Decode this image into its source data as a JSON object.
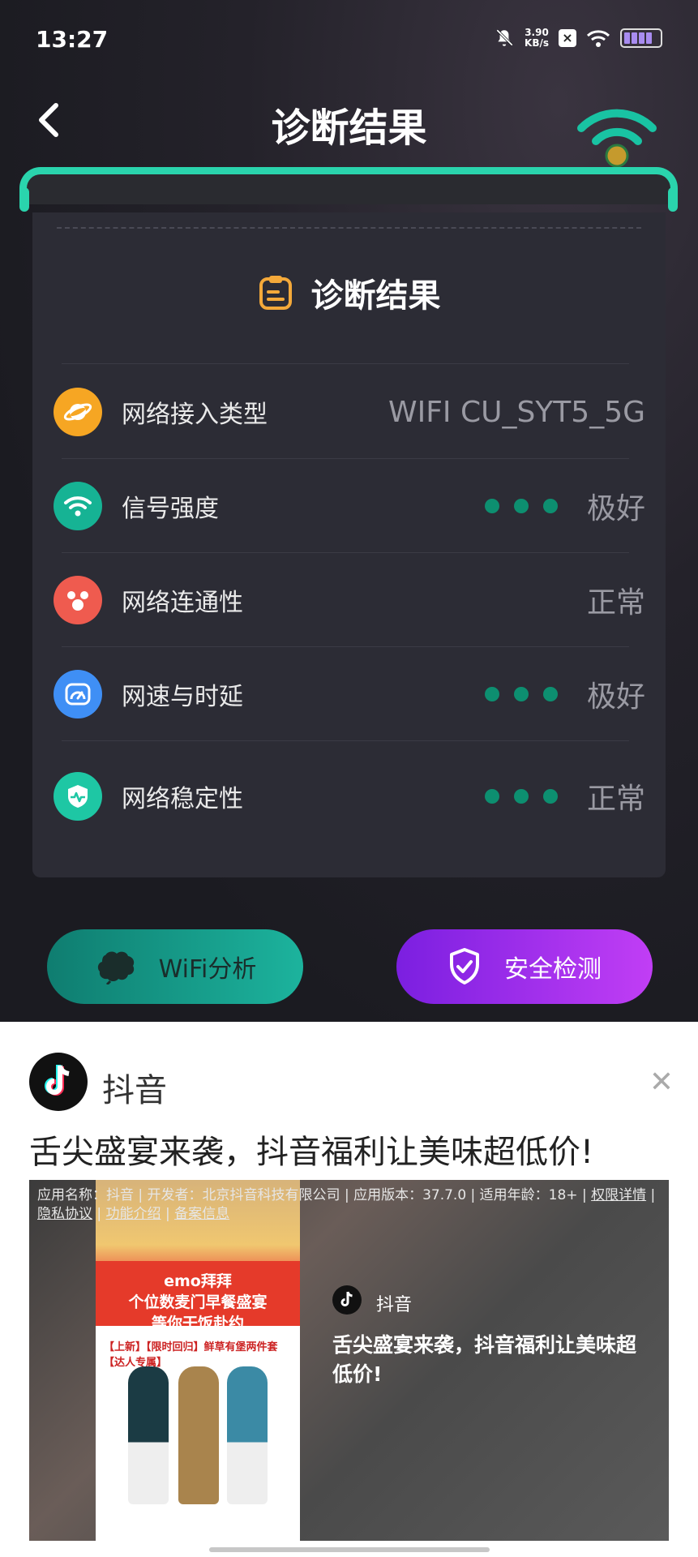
{
  "status_bar": {
    "time": "13:27",
    "speed_value": "3.90",
    "speed_unit": "KB/s"
  },
  "nav": {
    "title": "诊断结果"
  },
  "card": {
    "title": "诊断结果",
    "rows": [
      {
        "label": "网络接入类型",
        "value": "WIFI CU_SYT5_5G",
        "icon": "planet-icon",
        "color": "#f6a623",
        "dots": false
      },
      {
        "label": "信号强度",
        "value": "极好",
        "icon": "wifi-icon",
        "color": "#16b394",
        "dots": true
      },
      {
        "label": "网络连通性",
        "value": "正常",
        "icon": "connectivity-icon",
        "color": "#ef5b4f",
        "dots": false
      },
      {
        "label": "网速与时延",
        "value": "极好",
        "icon": "speedometer-icon",
        "color": "#3f8ff5",
        "dots": true
      },
      {
        "label": "网络稳定性",
        "value": "正常",
        "icon": "shield-pulse-icon",
        "color": "#1ec7a4",
        "dots": true
      }
    ]
  },
  "buttons": {
    "wifi_analysis": "WiFi分析",
    "security_check": "安全检测"
  },
  "ad": {
    "app_name": "抖音",
    "slogan": "舌尖盛宴来袭，抖音福利让美味超低价!",
    "info_text": "应用名称：抖音 | 开发者：北京抖音科技有限公司 | 应用版本：37.7.0 | 适用年龄：18+ | ",
    "info_link_permissions": "权限详情",
    "info_sep": " | ",
    "info_link_privacy": "隐私协议",
    "info_link_features": "功能介绍",
    "info_link_filing": "备案信息",
    "media_app_name": "抖音",
    "media_slogan": "舌尖盛宴来袭，抖音福利让美味超低价!",
    "phone_banner_line1": "emo拜拜",
    "phone_banner_line2": "个位数麦门早餐盛宴",
    "phone_banner_line3": "等你干饭赴约",
    "phone_product": "【上新】【限时回归】鲜草有堡两件套【达人专属】"
  }
}
